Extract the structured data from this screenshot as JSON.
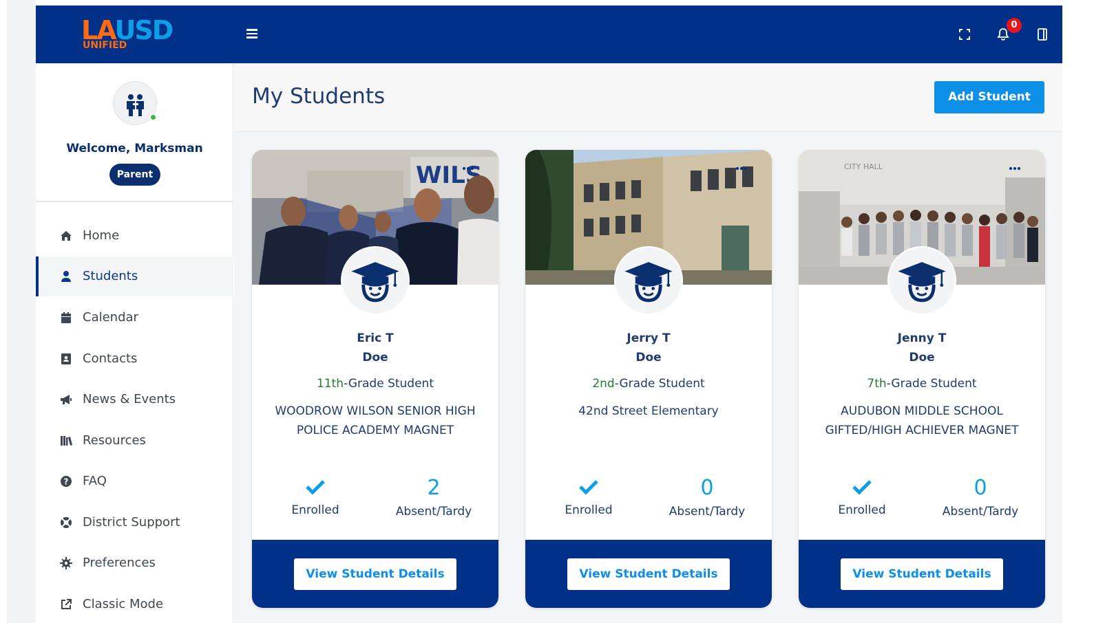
{
  "header": {
    "logo_line1_a": "LA",
    "logo_line1_b": "USD",
    "logo_line2": "UNIFIED",
    "notification_count": "0",
    "colors": {
      "bar": "#003087",
      "accent_orange": "#ff6a13",
      "accent_blue": "#0d9ee8",
      "badge": "#e8161b"
    }
  },
  "sidebar": {
    "welcome": "Welcome, Marksman",
    "role": "Parent",
    "items": [
      {
        "label": "Home",
        "icon": "home-icon"
      },
      {
        "label": "Students",
        "icon": "user-icon",
        "active": true
      },
      {
        "label": "Calendar",
        "icon": "calendar-icon"
      },
      {
        "label": "Contacts",
        "icon": "contacts-book-icon"
      },
      {
        "label": "News & Events",
        "icon": "megaphone-icon"
      },
      {
        "label": "Resources",
        "icon": "books-icon"
      },
      {
        "label": "FAQ",
        "icon": "question-circle-icon"
      },
      {
        "label": "District Support",
        "icon": "lifebuoy-icon"
      },
      {
        "label": "Preferences",
        "icon": "gear-icon"
      },
      {
        "label": "Classic Mode",
        "icon": "external-link-icon"
      }
    ]
  },
  "main": {
    "title": "My Students",
    "add_button": "Add Student",
    "students": [
      {
        "first": "Eric T",
        "last": "Doe",
        "grade_num": "11th",
        "grade_rest": "-Grade Student",
        "school": "WOODROW WILSON SENIOR HIGH POLICE ACADEMY MAGNET",
        "enrolled_label": "Enrolled",
        "absent_count": "2",
        "absent_label": "Absent/Tardy",
        "button": "View Student Details"
      },
      {
        "first": "Jerry T",
        "last": "Doe",
        "grade_num": "2nd",
        "grade_rest": "-Grade Student",
        "school": "42nd Street Elementary",
        "enrolled_label": "Enrolled",
        "absent_count": "0",
        "absent_label": "Absent/Tardy",
        "button": "View Student Details"
      },
      {
        "first": "Jenny T",
        "last": "Doe",
        "grade_num": "7th",
        "grade_rest": "-Grade Student",
        "school": "AUDUBON MIDDLE SCHOOL GIFTED/HIGH ACHIEVER MAGNET",
        "enrolled_label": "Enrolled",
        "absent_count": "0",
        "absent_label": "Absent/Tardy",
        "button": "View Student Details"
      }
    ]
  }
}
